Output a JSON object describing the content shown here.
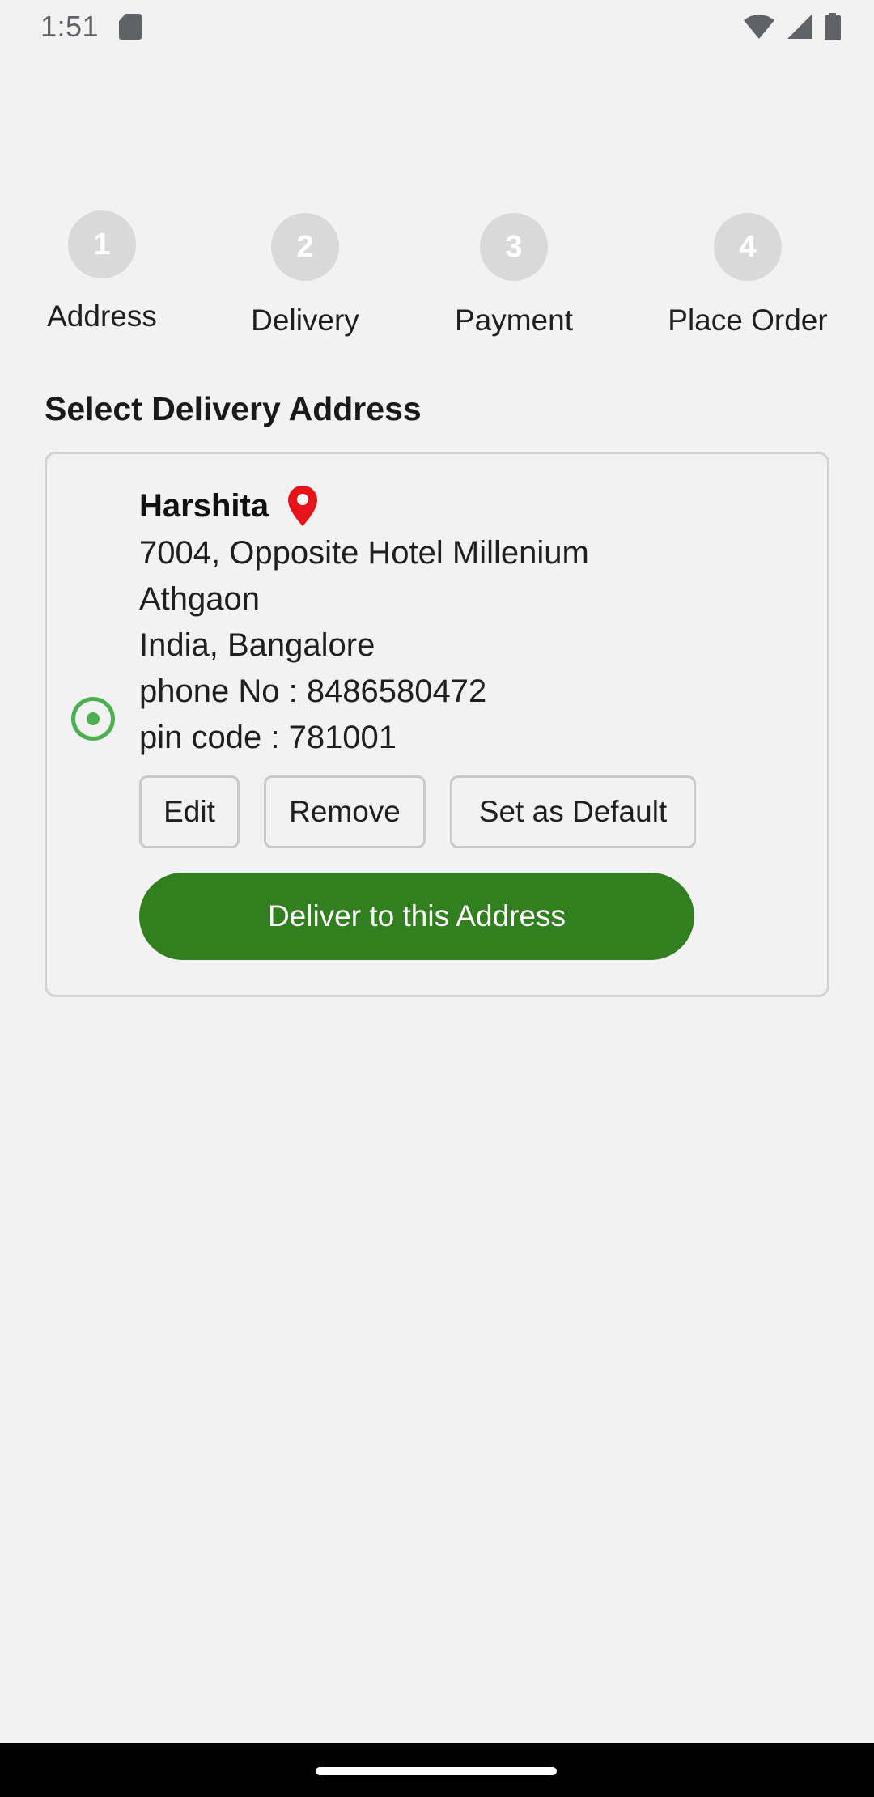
{
  "status_bar": {
    "time": "1:51",
    "icons": [
      "sd-card-icon",
      "wifi-icon",
      "signal-icon",
      "battery-icon"
    ]
  },
  "stepper": {
    "steps": [
      {
        "number": "1",
        "label": "Address"
      },
      {
        "number": "2",
        "label": "Delivery"
      },
      {
        "number": "3",
        "label": "Payment"
      },
      {
        "number": "4",
        "label": "Place Order"
      }
    ]
  },
  "section_title": "Select Delivery Address",
  "address": {
    "name": "Harshita",
    "line1": "7004, Opposite Hotel Millenium",
    "line2": "Athgaon",
    "line3": "India, Bangalore",
    "phone": "phone No : 8486580472",
    "pincode": "pin code : 781001",
    "selected": true,
    "buttons": {
      "edit": "Edit",
      "remove": "Remove",
      "set_default": "Set as Default",
      "deliver": "Deliver to this Address"
    }
  },
  "colors": {
    "accent_green": "#317f1e",
    "radio_green": "#4caf50",
    "pin_red": "#e8141b",
    "step_inactive": "#d9d9d9"
  }
}
